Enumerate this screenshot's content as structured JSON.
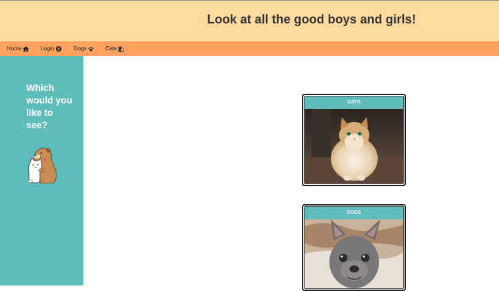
{
  "header": {
    "title": "Look at all the good boys and girls!"
  },
  "nav": {
    "items": [
      {
        "label": "Home",
        "icon": "home-icon"
      },
      {
        "label": "Login",
        "icon": "user-circle-icon"
      },
      {
        "label": "Dogs",
        "icon": "paw-icon"
      },
      {
        "label": "Cats",
        "icon": "cat-icon"
      }
    ]
  },
  "sidebar": {
    "question": "Which would you like to see?",
    "illustration": "dog-and-cat-hugging-illustration"
  },
  "cards": [
    {
      "title": "CATS",
      "image": "fluffy-cat-photo"
    },
    {
      "title": "DOGS",
      "image": "french-bulldog-photo"
    }
  ],
  "colors": {
    "header_bg": "#ffdb9f",
    "nav_bg": "#ffa25f",
    "accent_teal": "#5ebcbb"
  }
}
